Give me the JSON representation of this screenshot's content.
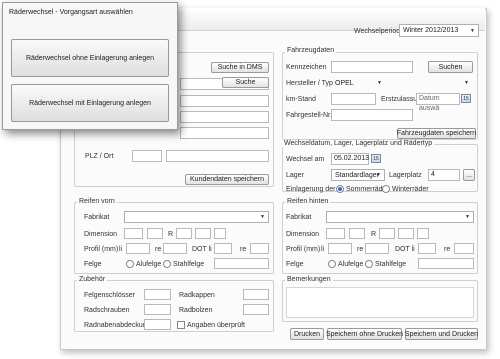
{
  "popup": {
    "title": "Räderwechsel - Vorgangsart auswählen",
    "btn_without": "Räderwechsel ohne Einlagerung anlegen",
    "btn_with": "Räderwechsel mit Einlagerung anlegen"
  },
  "header": {
    "period_label": "Wechselperiode",
    "period_value": "Winter 2012/2013"
  },
  "customer": {
    "search_dms": "Suche in DMS",
    "search": "Suche",
    "plz_label": "PLZ / Ort",
    "save": "Kundendaten speichern"
  },
  "vehicle": {
    "title": "Fahrzeugdaten",
    "kennzeichen_label": "Kennzeichen",
    "search": "Suchen",
    "hersteller_label": "Hersteller / Typ",
    "hersteller_value": "OPEL",
    "km_label": "km-Stand",
    "erstzulassung_label": "Erstzulassung",
    "datum_placeholder": "Datum auswä",
    "fahrgestell_label": "Fahrgestell-Nr.",
    "save": "Fahrzeugdaten speichern"
  },
  "change": {
    "title": "Wechseldatum, Lager, Lagerplatz und Rädertyp",
    "date_label": "Wechsel am",
    "date_value": "05.02.2013",
    "lager_label": "Lager",
    "lager_value": "Standardlager",
    "lagerplatz_label": "Lagerplatz",
    "lagerplatz_value": "4",
    "more": "...",
    "einlagerung_label": "Einlagerung der",
    "opt_summer": "Sommerräder",
    "opt_winter": "Winterräder"
  },
  "front": {
    "title": "Reifen vorn",
    "fabrikat": "Fabrikat",
    "dimension": "Dimension",
    "r": "R",
    "profil": "Profil (mm)",
    "li": "li",
    "re": "re",
    "dot_li": "DOT li",
    "dot_re": "re",
    "felge": "Felge",
    "alu": "Alufelge",
    "stahl": "Stahlfelge"
  },
  "rear": {
    "title": "Reifen hinten",
    "fabrikat": "Fabrikat",
    "dimension": "Dimension",
    "r": "R",
    "profil": "Profil (mm)",
    "li": "li",
    "re": "re",
    "dot_li": "DOT li",
    "dot_re": "re",
    "felge": "Felge",
    "alu": "Alufelge",
    "stahl": "Stahlfelge"
  },
  "accessories": {
    "title": "Zubehör",
    "felgenschloesser": "Felgenschlösser",
    "radkappen": "Radkappen",
    "radschrauben": "Radschrauben",
    "radbolzen": "Radbolzen",
    "radnaben": "Radnabenabdeckung",
    "angaben": "Angaben überprüft"
  },
  "remarks": {
    "title": "Bemerkungen"
  },
  "footer": {
    "print": "Drucken",
    "save_no_print": "Speichern ohne Drucken",
    "save_print": "Speichern und Drucken"
  },
  "icons": {
    "dropdown": "chevron-down-icon",
    "calendar": "calendar-icon"
  }
}
